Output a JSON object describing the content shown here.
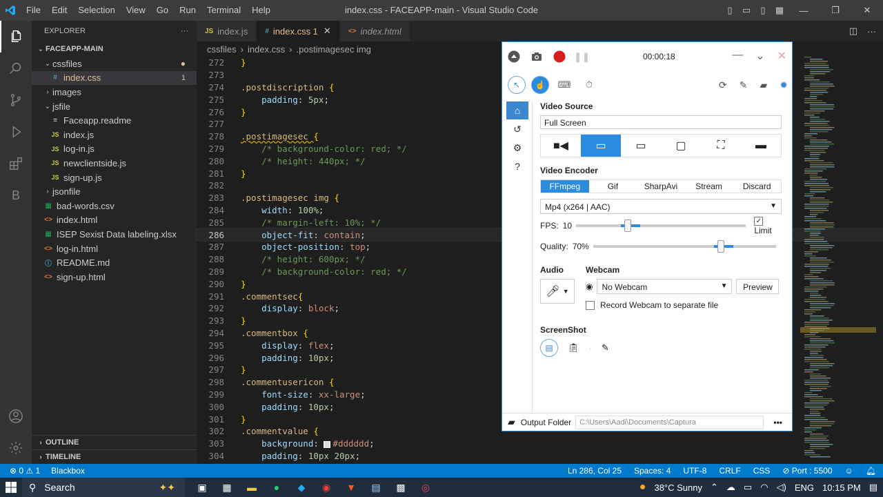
{
  "titlebar": {
    "menu": [
      "File",
      "Edit",
      "Selection",
      "View",
      "Go",
      "Run",
      "Terminal",
      "Help"
    ],
    "title": "index.css - FACEAPP-main - Visual Studio Code"
  },
  "explorer": {
    "header": "EXPLORER",
    "more": "···",
    "root": "FACEAPP-MAIN",
    "items": [
      {
        "label": "cssfiles",
        "type": "folder-open",
        "indent": 1,
        "modified": true
      },
      {
        "label": "index.css",
        "type": "css",
        "indent": 2,
        "selected": true,
        "badge": "1"
      },
      {
        "label": "images",
        "type": "folder",
        "indent": 1
      },
      {
        "label": "jsfile",
        "type": "folder-open",
        "indent": 1
      },
      {
        "label": "Faceapp.readme",
        "type": "file",
        "indent": 2
      },
      {
        "label": "index.js",
        "type": "js",
        "indent": 2
      },
      {
        "label": "log-in.js",
        "type": "js",
        "indent": 2
      },
      {
        "label": "newclientside.js",
        "type": "js",
        "indent": 2
      },
      {
        "label": "sign-up.js",
        "type": "js",
        "indent": 2
      },
      {
        "label": "jsonfile",
        "type": "folder",
        "indent": 1
      },
      {
        "label": "bad-words.csv",
        "type": "xls",
        "indent": 1
      },
      {
        "label": "index.html",
        "type": "html",
        "indent": 1
      },
      {
        "label": "ISEP Sexist Data labeling.xlsx",
        "type": "xls",
        "indent": 1
      },
      {
        "label": "log-in.html",
        "type": "html",
        "indent": 1
      },
      {
        "label": "README.md",
        "type": "md",
        "indent": 1
      },
      {
        "label": "sign-up.html",
        "type": "html",
        "indent": 1
      }
    ],
    "outline": "OUTLINE",
    "timeline": "TIMELINE"
  },
  "tabs": [
    {
      "icon": "JS",
      "label": "index.js",
      "active": false
    },
    {
      "icon": "#",
      "label": "index.css 1",
      "active": true
    },
    {
      "icon": "<>",
      "label": "index.html",
      "active": false
    }
  ],
  "breadcrumb": [
    "cssfiles",
    "index.css",
    ".postimagesec img"
  ],
  "code": {
    "current_line": 286,
    "lines": [
      {
        "n": 272,
        "t": [
          [
            "brace",
            "}"
          ]
        ]
      },
      {
        "n": 273,
        "t": []
      },
      {
        "n": 274,
        "t": [
          [
            "sel-c",
            ".postdiscription "
          ],
          [
            "brace",
            "{"
          ]
        ]
      },
      {
        "n": 275,
        "t": [
          [
            "prop",
            "    padding"
          ],
          [
            "punct",
            ": "
          ],
          [
            "num",
            "5px"
          ],
          [
            "punct",
            ";"
          ]
        ]
      },
      {
        "n": 276,
        "t": [
          [
            "brace",
            "}"
          ]
        ]
      },
      {
        "n": 277,
        "t": []
      },
      {
        "n": 278,
        "t": [
          [
            "sel-c",
            ".postimagesec "
          ],
          [
            "brace",
            "{"
          ]
        ]
      },
      {
        "n": 279,
        "t": [
          [
            "cmt",
            "    /* background-color: red; */"
          ]
        ]
      },
      {
        "n": 280,
        "t": [
          [
            "cmt",
            "    /* height: 440px; */"
          ]
        ]
      },
      {
        "n": 281,
        "t": [
          [
            "brace",
            "}"
          ]
        ]
      },
      {
        "n": 282,
        "t": []
      },
      {
        "n": 283,
        "t": [
          [
            "sel-c",
            ".postimagesec img "
          ],
          [
            "brace",
            "{"
          ]
        ]
      },
      {
        "n": 284,
        "t": [
          [
            "prop",
            "    width"
          ],
          [
            "punct",
            ": "
          ],
          [
            "num",
            "100%"
          ],
          [
            "punct",
            ";"
          ]
        ]
      },
      {
        "n": 285,
        "t": [
          [
            "cmt",
            "    /* margin-left: 10%; */"
          ]
        ]
      },
      {
        "n": 286,
        "t": [
          [
            "prop",
            "    object-fit"
          ],
          [
            "punct",
            ": "
          ],
          [
            "val",
            "contain"
          ],
          [
            "punct",
            ";"
          ]
        ]
      },
      {
        "n": 287,
        "t": [
          [
            "prop",
            "    object-position"
          ],
          [
            "punct",
            ": "
          ],
          [
            "val",
            "top"
          ],
          [
            "punct",
            ";"
          ]
        ]
      },
      {
        "n": 288,
        "t": [
          [
            "cmt",
            "    /* height: 600px; */"
          ]
        ]
      },
      {
        "n": 289,
        "t": [
          [
            "cmt",
            "    /* background-color: red; */"
          ]
        ]
      },
      {
        "n": 290,
        "t": [
          [
            "brace",
            "}"
          ]
        ]
      },
      {
        "n": 291,
        "t": [
          [
            "sel-c",
            ".commentsec"
          ],
          [
            "brace",
            "{"
          ]
        ]
      },
      {
        "n": 292,
        "t": [
          [
            "prop",
            "    display"
          ],
          [
            "punct",
            ": "
          ],
          [
            "val",
            "block"
          ],
          [
            "punct",
            ";"
          ]
        ]
      },
      {
        "n": 293,
        "t": [
          [
            "brace",
            "}"
          ]
        ]
      },
      {
        "n": 294,
        "t": [
          [
            "sel-c",
            ".commentbox "
          ],
          [
            "brace",
            "{"
          ]
        ]
      },
      {
        "n": 295,
        "t": [
          [
            "prop",
            "    display"
          ],
          [
            "punct",
            ": "
          ],
          [
            "val",
            "flex"
          ],
          [
            "punct",
            ";"
          ]
        ]
      },
      {
        "n": 296,
        "t": [
          [
            "prop",
            "    padding"
          ],
          [
            "punct",
            ": "
          ],
          [
            "num",
            "10px"
          ],
          [
            "punct",
            ";"
          ]
        ]
      },
      {
        "n": 297,
        "t": [
          [
            "brace",
            "}"
          ]
        ]
      },
      {
        "n": 298,
        "t": [
          [
            "sel-c",
            ".commentusericon "
          ],
          [
            "brace",
            "{"
          ]
        ]
      },
      {
        "n": 299,
        "t": [
          [
            "prop",
            "    font-size"
          ],
          [
            "punct",
            ": "
          ],
          [
            "val",
            "xx-large"
          ],
          [
            "punct",
            ";"
          ]
        ]
      },
      {
        "n": 300,
        "t": [
          [
            "prop",
            "    padding"
          ],
          [
            "punct",
            ": "
          ],
          [
            "num",
            "10px"
          ],
          [
            "punct",
            ";"
          ]
        ]
      },
      {
        "n": 301,
        "t": [
          [
            "brace",
            "}"
          ]
        ]
      },
      {
        "n": 302,
        "t": [
          [
            "sel-c",
            ".commentvalue "
          ],
          [
            "brace",
            "{"
          ]
        ]
      },
      {
        "n": 303,
        "t": [
          [
            "prop",
            "    background"
          ],
          [
            "punct",
            ": "
          ],
          [
            "swatch",
            ""
          ],
          [
            "val",
            "#dddddd"
          ],
          [
            "punct",
            ";"
          ]
        ]
      },
      {
        "n": 304,
        "t": [
          [
            "prop",
            "    padding"
          ],
          [
            "punct",
            ": "
          ],
          [
            "num",
            "10px 20px"
          ],
          [
            "punct",
            ";"
          ]
        ]
      }
    ]
  },
  "statusbar": {
    "errors": "⊗ 0 ⚠ 1",
    "extension": "Blackbox",
    "position": "Ln 286, Col 25",
    "spaces": "Spaces: 4",
    "encoding": "UTF-8",
    "eol": "CRLF",
    "language": "CSS",
    "port": "⊘ Port : 5500"
  },
  "taskbar": {
    "search": "Search",
    "weather": "38°C  Sunny",
    "lang": "ENG",
    "time": "10:15 PM"
  },
  "captura": {
    "timer": "00:00:18",
    "video_source_title": "Video Source",
    "video_source_value": "Full Screen",
    "video_encoder_title": "Video Encoder",
    "encoders": [
      "FFmpeg",
      "Gif",
      "SharpAvi",
      "Stream",
      "Discard"
    ],
    "codec": "Mp4 (x264 | AAC)",
    "fps_label": "FPS:",
    "fps_value": "10",
    "fps_fraction": 0.3,
    "limit_label": "Limit",
    "quality_label": "Quality:",
    "quality_value": "70%",
    "quality_fraction": 0.7,
    "audio_title": "Audio",
    "webcam_title": "Webcam",
    "webcam_value": "No Webcam",
    "preview_label": "Preview",
    "record_webcam_label": "Record Webcam to separate file",
    "screenshot_title": "ScreenShot",
    "output_label": "Output Folder",
    "output_path": "C:\\Users\\Aadi\\Documents\\Captura",
    "more": "•••",
    "accent": "#2a8bdf"
  }
}
